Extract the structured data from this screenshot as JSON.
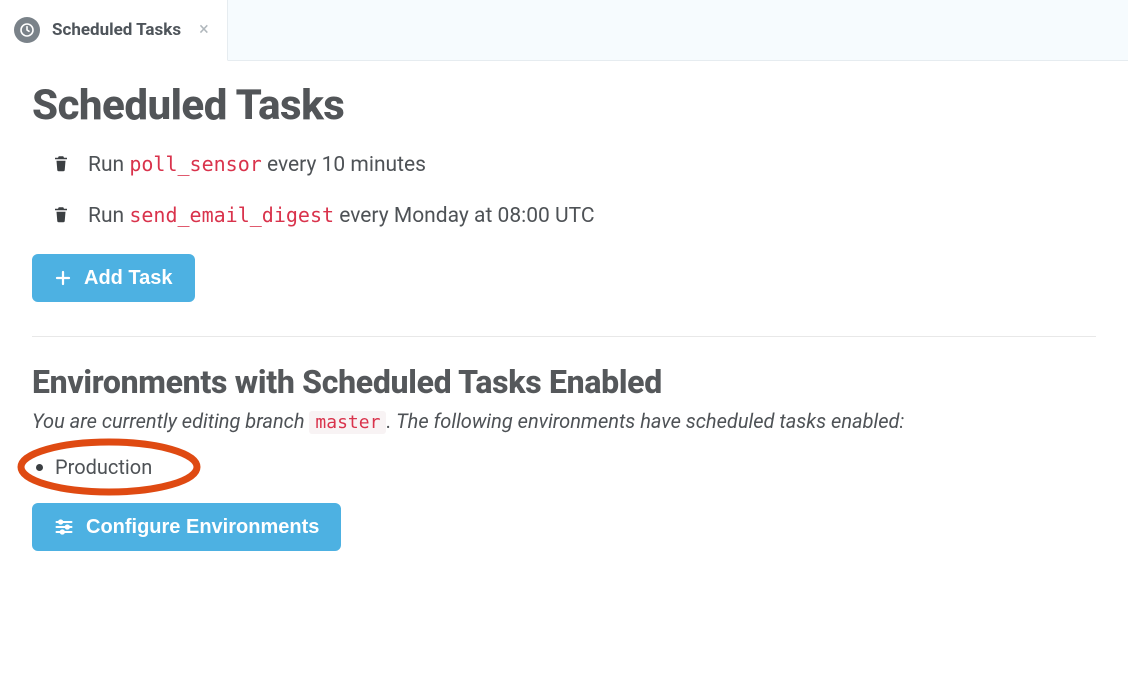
{
  "tab": {
    "title": "Scheduled Tasks"
  },
  "page": {
    "title": "Scheduled Tasks"
  },
  "tasks": [
    {
      "prefix": "Run ",
      "code": "poll_sensor",
      "suffix": " every 10 minutes"
    },
    {
      "prefix": "Run ",
      "code": "send_email_digest",
      "suffix": " every Monday at 08:00 UTC"
    }
  ],
  "buttons": {
    "add_task": "Add Task",
    "configure_envs": "Configure Environments"
  },
  "environments": {
    "heading": "Environments with Scheduled Tasks Enabled",
    "branch_line_prefix": "You are currently editing branch ",
    "branch_name": "master",
    "branch_line_suffix": ". The following environments have scheduled tasks enabled:",
    "items": [
      {
        "name": "Production"
      }
    ]
  },
  "colors": {
    "accent_blue": "#4db1e2",
    "code_red": "#d9334c",
    "highlight_ring": "#df4a12"
  }
}
